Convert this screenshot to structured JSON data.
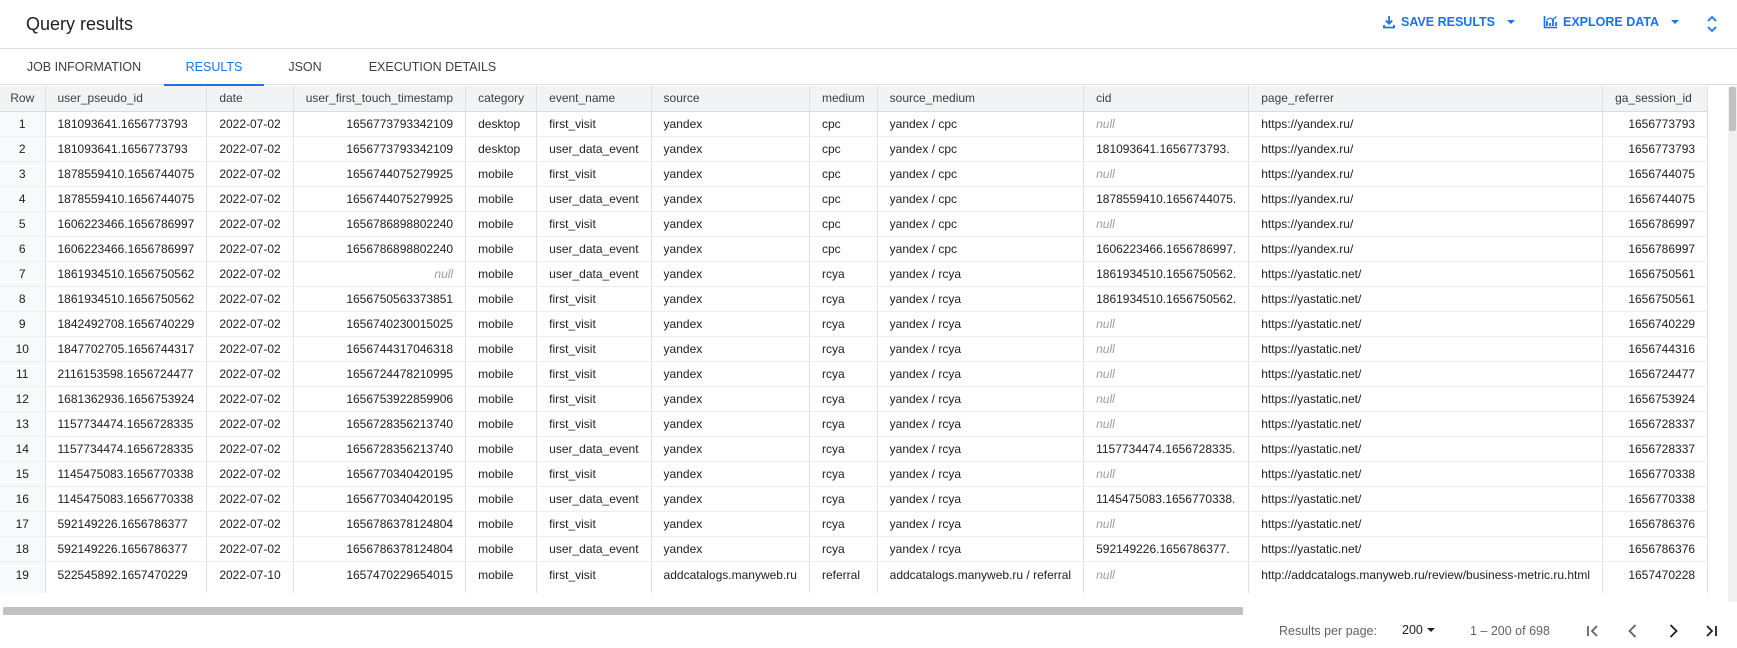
{
  "header": {
    "title": "Query results",
    "save_results_label": "SAVE RESULTS",
    "explore_data_label": "EXPLORE DATA"
  },
  "tabs": [
    {
      "label": "JOB INFORMATION"
    },
    {
      "label": "RESULTS"
    },
    {
      "label": "JSON"
    },
    {
      "label": "EXECUTION DETAILS"
    }
  ],
  "table": {
    "columns": [
      "Row",
      "user_pseudo_id",
      "date",
      "user_first_touch_timestamp",
      "category",
      "event_name",
      "source",
      "medium",
      "source_medium",
      "cid",
      "page_referrer",
      "ga_session_id"
    ],
    "rows": [
      [
        "1",
        "181093641.1656773793",
        "2022-07-02",
        "1656773793342109",
        "desktop",
        "first_visit",
        "yandex",
        "cpc",
        "yandex / cpc",
        "null",
        "https://yandex.ru/",
        "1656773793"
      ],
      [
        "2",
        "181093641.1656773793",
        "2022-07-02",
        "1656773793342109",
        "desktop",
        "user_data_event",
        "yandex",
        "cpc",
        "yandex / cpc",
        "181093641.1656773793.",
        "https://yandex.ru/",
        "1656773793"
      ],
      [
        "3",
        "1878559410.1656744075",
        "2022-07-02",
        "1656744075279925",
        "mobile",
        "first_visit",
        "yandex",
        "cpc",
        "yandex / cpc",
        "null",
        "https://yandex.ru/",
        "1656744075"
      ],
      [
        "4",
        "1878559410.1656744075",
        "2022-07-02",
        "1656744075279925",
        "mobile",
        "user_data_event",
        "yandex",
        "cpc",
        "yandex / cpc",
        "1878559410.1656744075.",
        "https://yandex.ru/",
        "1656744075"
      ],
      [
        "5",
        "1606223466.1656786997",
        "2022-07-02",
        "1656786898802240",
        "mobile",
        "first_visit",
        "yandex",
        "cpc",
        "yandex / cpc",
        "null",
        "https://yandex.ru/",
        "1656786997"
      ],
      [
        "6",
        "1606223466.1656786997",
        "2022-07-02",
        "1656786898802240",
        "mobile",
        "user_data_event",
        "yandex",
        "cpc",
        "yandex / cpc",
        "1606223466.1656786997.",
        "https://yandex.ru/",
        "1656786997"
      ],
      [
        "7",
        "1861934510.1656750562",
        "2022-07-02",
        "null",
        "mobile",
        "user_data_event",
        "yandex",
        "rcya",
        "yandex / rcya",
        "1861934510.1656750562.",
        "https://yastatic.net/",
        "1656750561"
      ],
      [
        "8",
        "1861934510.1656750562",
        "2022-07-02",
        "1656750563373851",
        "mobile",
        "first_visit",
        "yandex",
        "rcya",
        "yandex / rcya",
        "1861934510.1656750562.",
        "https://yastatic.net/",
        "1656750561"
      ],
      [
        "9",
        "1842492708.1656740229",
        "2022-07-02",
        "1656740230015025",
        "mobile",
        "first_visit",
        "yandex",
        "rcya",
        "yandex / rcya",
        "null",
        "https://yastatic.net/",
        "1656740229"
      ],
      [
        "10",
        "1847702705.1656744317",
        "2022-07-02",
        "1656744317046318",
        "mobile",
        "first_visit",
        "yandex",
        "rcya",
        "yandex / rcya",
        "null",
        "https://yastatic.net/",
        "1656744316"
      ],
      [
        "11",
        "2116153598.1656724477",
        "2022-07-02",
        "1656724478210995",
        "mobile",
        "first_visit",
        "yandex",
        "rcya",
        "yandex / rcya",
        "null",
        "https://yastatic.net/",
        "1656724477"
      ],
      [
        "12",
        "1681362936.1656753924",
        "2022-07-02",
        "1656753922859906",
        "mobile",
        "first_visit",
        "yandex",
        "rcya",
        "yandex / rcya",
        "null",
        "https://yastatic.net/",
        "1656753924"
      ],
      [
        "13",
        "1157734474.1656728335",
        "2022-07-02",
        "1656728356213740",
        "mobile",
        "first_visit",
        "yandex",
        "rcya",
        "yandex / rcya",
        "null",
        "https://yastatic.net/",
        "1656728337"
      ],
      [
        "14",
        "1157734474.1656728335",
        "2022-07-02",
        "1656728356213740",
        "mobile",
        "user_data_event",
        "yandex",
        "rcya",
        "yandex / rcya",
        "1157734474.1656728335.",
        "https://yastatic.net/",
        "1656728337"
      ],
      [
        "15",
        "1145475083.1656770338",
        "2022-07-02",
        "1656770340420195",
        "mobile",
        "first_visit",
        "yandex",
        "rcya",
        "yandex / rcya",
        "null",
        "https://yastatic.net/",
        "1656770338"
      ],
      [
        "16",
        "1145475083.1656770338",
        "2022-07-02",
        "1656770340420195",
        "mobile",
        "user_data_event",
        "yandex",
        "rcya",
        "yandex / rcya",
        "1145475083.1656770338.",
        "https://yastatic.net/",
        "1656770338"
      ],
      [
        "17",
        "592149226.1656786377",
        "2022-07-02",
        "1656786378124804",
        "mobile",
        "first_visit",
        "yandex",
        "rcya",
        "yandex / rcya",
        "null",
        "https://yastatic.net/",
        "1656786376"
      ],
      [
        "18",
        "592149226.1656786377",
        "2022-07-02",
        "1656786378124804",
        "mobile",
        "user_data_event",
        "yandex",
        "rcya",
        "yandex / rcya",
        "592149226.1656786377.",
        "https://yastatic.net/",
        "1656786376"
      ],
      [
        "19",
        "522545892.1657470229",
        "2022-07-10",
        "1657470229654015",
        "mobile",
        "first_visit",
        "addcatalogs.manyweb.ru",
        "referral",
        "addcatalogs.manyweb.ru / referral",
        "null",
        "http://addcatalogs.manyweb.ru/review/business-metric.ru.html",
        "1657470228"
      ]
    ]
  },
  "footer": {
    "rows_per_page_label": "Results per page:",
    "rows_per_page_value": "200",
    "range_text": "1 – 200 of 698"
  },
  "colors": {
    "accent": "#1a73e8",
    "null_text": "#9aa0a6",
    "header_bg": "#f1f3f4"
  }
}
